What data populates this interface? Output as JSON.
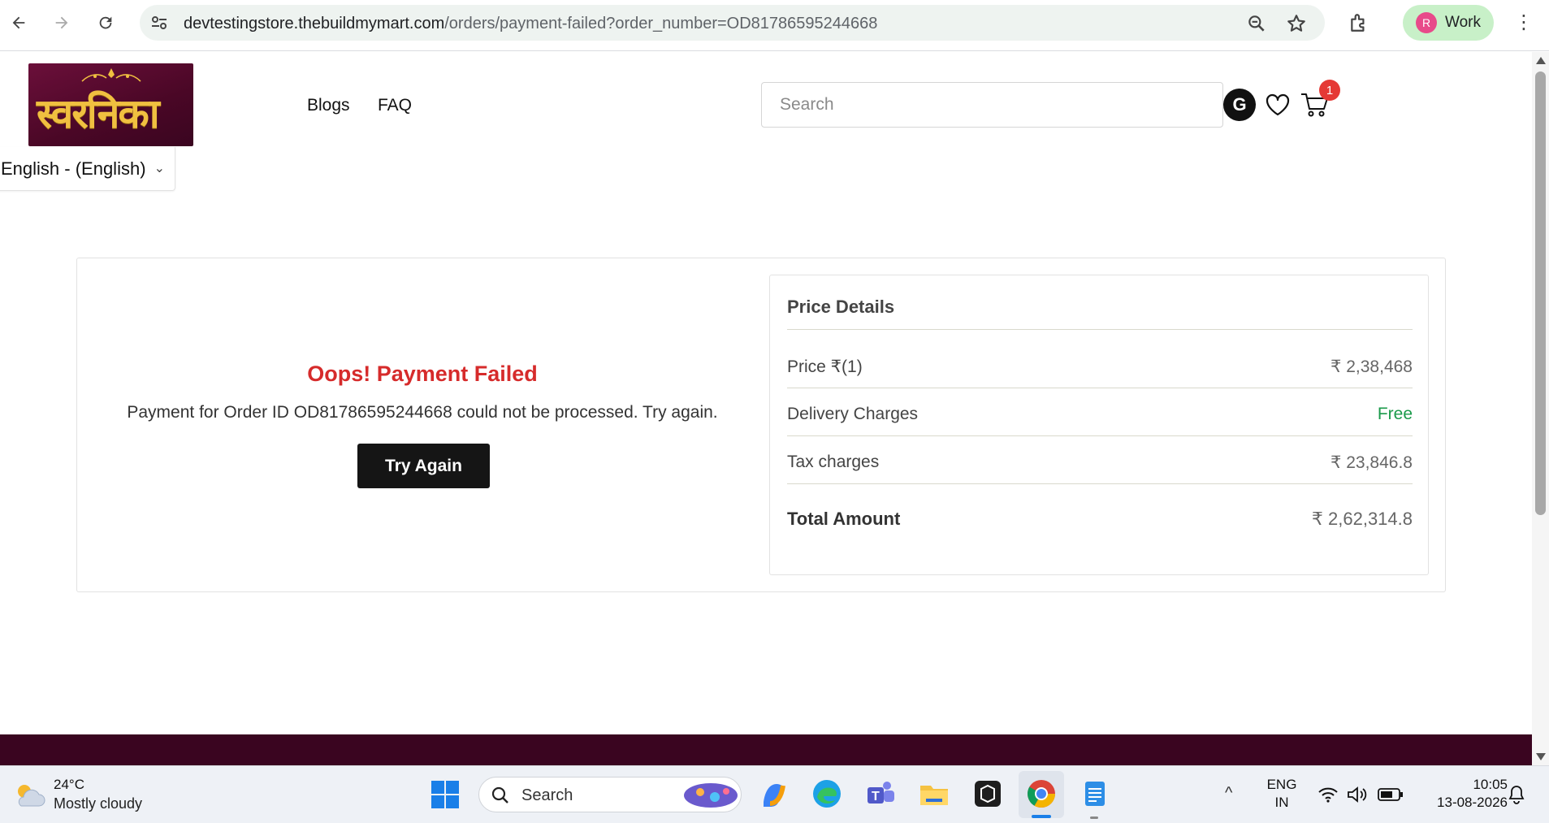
{
  "browser": {
    "url_host": "devtestingstore.thebuildmymart.com",
    "url_path": "/orders/payment-failed?order_number=OD81786595244668",
    "profile_initial": "R",
    "profile_label": "Work"
  },
  "header": {
    "logo_text": "स्वरनिका",
    "menu": [
      "Blogs",
      "FAQ"
    ],
    "search_placeholder": "Search",
    "user_initial": "G",
    "cart_count": "1",
    "language": "English - (English)"
  },
  "payment": {
    "title": "Oops! Payment Failed",
    "message": "Payment for Order ID OD81786595244668 could not be processed. Try again.",
    "button": "Try Again"
  },
  "price_details": {
    "title": "Price Details",
    "rows": [
      {
        "label": "Price ₹(1)",
        "value": "₹ 2,38,468"
      },
      {
        "label": "Delivery Charges",
        "value": "Free"
      },
      {
        "label": "Tax charges",
        "value": "₹ 23,846.8"
      }
    ],
    "total_label": "Total Amount",
    "total_value": "₹ 2,62,314.8",
    "free_color": "#1a9a4a"
  },
  "colors": {
    "error_red": "#d62b2b",
    "brand_maroon": "#3a0520",
    "button_dark": "#151515"
  },
  "taskbar": {
    "temperature": "24°C",
    "condition": "Mostly cloudy",
    "search_placeholder": "Search",
    "lang_line1": "ENG",
    "lang_line2": "IN",
    "time": "10:05",
    "date": "13-08-2026"
  }
}
